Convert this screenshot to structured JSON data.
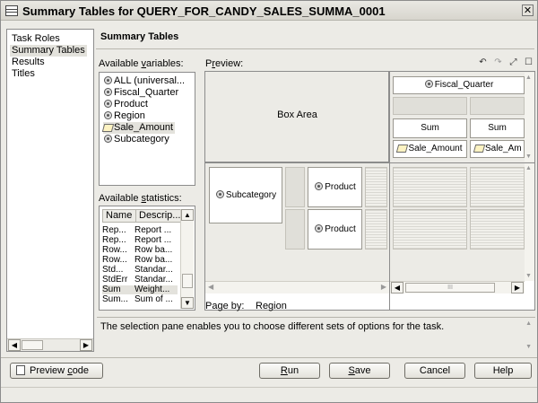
{
  "window": {
    "title": "Summary Tables for QUERY_FOR_CANDY_SALES_SUMMA_0001",
    "close_glyph": "✕"
  },
  "nav": {
    "items": [
      "Task Roles",
      "Summary Tables",
      "Results",
      "Titles"
    ],
    "selected": "Summary Tables"
  },
  "main": {
    "heading": "Summary Tables"
  },
  "variables": {
    "label_pre": "Available ",
    "label_key": "v",
    "label_post": "ariables:",
    "items": [
      {
        "name": "ALL (universal...",
        "icon": "category-icon"
      },
      {
        "name": "Fiscal_Quarter",
        "icon": "category-icon"
      },
      {
        "name": "Product",
        "icon": "category-icon"
      },
      {
        "name": "Region",
        "icon": "category-icon"
      },
      {
        "name": "Sale_Amount",
        "icon": "numeric-icon",
        "selected": true
      },
      {
        "name": "Subcategory",
        "icon": "category-icon"
      }
    ]
  },
  "statistics": {
    "label_pre": "Available ",
    "label_key": "s",
    "label_post": "tatistics:",
    "col_name": "Name",
    "col_desc": "Descrip...",
    "rows": [
      [
        "Rep...",
        "Report ..."
      ],
      [
        "Rep...",
        "Report ..."
      ],
      [
        "Row...",
        "Row ba..."
      ],
      [
        "Row...",
        "Row ba..."
      ],
      [
        "Std...",
        "Standar..."
      ],
      [
        "StdErr",
        "Standar..."
      ],
      [
        "Sum",
        "Weight..."
      ],
      [
        "Sum...",
        "Sum of ..."
      ]
    ],
    "selected_index": 6
  },
  "preview": {
    "label_pre": "P",
    "label_key": "r",
    "label_post": "eview:",
    "box_area": "Box Area",
    "column_var": "Fiscal_Quarter",
    "stat_left": "Sum",
    "stat_right": "Sum",
    "analysis_left": "Sale_Amount",
    "analysis_right": "Sale_Am",
    "row_var": "Subcategory",
    "row_product_1": "Product",
    "row_product_2": "Product",
    "page_by_label": "Page by:",
    "page_by_value": "Region",
    "hscroll_grip": "III"
  },
  "description": "The selection pane enables you to choose different sets of options for the task.",
  "buttons": {
    "preview_code_pre": "Preview ",
    "preview_code_key": "c",
    "preview_code_post": "ode",
    "run_key": "R",
    "run_post": "un",
    "save_key": "S",
    "save_post": "ave",
    "cancel": "Cancel",
    "help": "Help"
  }
}
